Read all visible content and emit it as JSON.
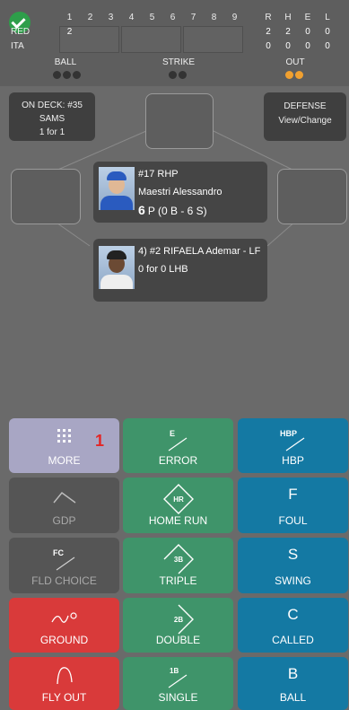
{
  "scoreboard": {
    "teams": [
      "RED",
      "ITA"
    ],
    "innings": [
      "1",
      "2",
      "3",
      "4",
      "5",
      "6",
      "7",
      "8",
      "9"
    ],
    "innings_scores": [
      [
        "2",
        "",
        "",
        "",
        "",
        "",
        "",
        "",
        ""
      ],
      [
        "",
        "",
        "",
        "",
        "",
        "",
        "",
        "",
        ""
      ]
    ],
    "stat_headers": [
      "R",
      "H",
      "E",
      "L"
    ],
    "stats": [
      [
        "2",
        "2",
        "0",
        "0"
      ],
      [
        "0",
        "0",
        "0",
        "0"
      ]
    ],
    "ball_label": "BALL",
    "strike_label": "STRIKE",
    "out_label": "OUT",
    "balls": 0,
    "strikes": 0,
    "outs": 2,
    "colors": {
      "check": "#2e9e4a",
      "out_dot": "#f0a030"
    }
  },
  "on_deck": {
    "line1": "ON DECK: #35",
    "line2": "SAMS",
    "line3": "1 for 1"
  },
  "defense": {
    "line1": "DEFENSE",
    "line2": "View/Change"
  },
  "pitcher": {
    "number_role": "#17 RHP",
    "name": "Maestri Alessandro",
    "pitch_count": "6",
    "pitch_detail": "P (0 B - 6 S)"
  },
  "batter": {
    "order_name": "4) #2 RIFAELA Ademar - LF",
    "stats": "0 for 0 LHB"
  },
  "buttons": {
    "more": "MORE",
    "error": "ERROR",
    "hbp": "HBP",
    "gdp": "GDP",
    "home_run": "HOME RUN",
    "foul": "FOUL",
    "fld_choice": "FLD CHOICE",
    "triple": "TRIPLE",
    "swing": "SWING",
    "ground": "GROUND",
    "double": "DOUBLE",
    "called": "CALLED",
    "fly_out": "FLY OUT",
    "single": "SINGLE",
    "ball": "BALL"
  },
  "button_glyphs": {
    "error": "E",
    "hbp": "HBP",
    "home_run": "HR",
    "foul": "F",
    "fld_choice": "FC",
    "triple": "3B",
    "swing": "S",
    "double": "2B",
    "called": "C",
    "single": "1B",
    "ball": "B"
  },
  "annotation": "1",
  "colors": {
    "purple": "#a8a6c4",
    "green": "#3f946a",
    "blue": "#1479a3",
    "red": "#d93a3a",
    "gray": "#555555"
  }
}
